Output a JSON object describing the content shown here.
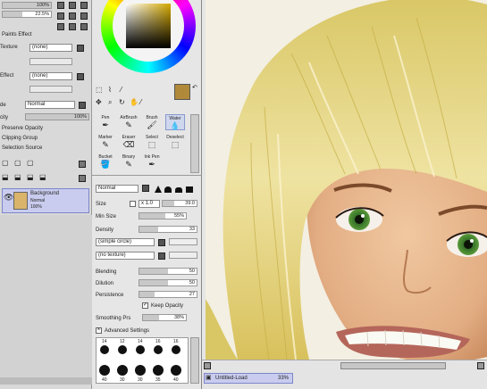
{
  "layer_panel": {
    "top_values": [
      "100%",
      "22.5%"
    ],
    "paper_effect_title": "Paints Effect",
    "texture_label": "Texture",
    "texture_value": "(none)",
    "effect_label": "Effect",
    "effect_value": "(none)",
    "mode_label": "de",
    "mode_value": "Normal",
    "opacity_label": "city",
    "opacity_value": "100%",
    "preserve_opacity": "Preserve Opacity",
    "clipping_group": "Clipping Group",
    "selection_source": "Selection Source",
    "layer": {
      "name": "Background",
      "mode": "Normal",
      "opacity": "100%"
    }
  },
  "tool_panel": {
    "tools_row1": [
      {
        "name": "Pen",
        "glyph": "✒"
      },
      {
        "name": "AirBrush",
        "glyph": "✎"
      },
      {
        "name": "Brush",
        "glyph": "🖌"
      },
      {
        "name": "Water",
        "glyph": "💧"
      }
    ],
    "tools_row2": [
      {
        "name": "Marker",
        "glyph": "✎"
      },
      {
        "name": "Eraser",
        "glyph": "⌫"
      },
      {
        "name": "Select",
        "glyph": "⬚"
      },
      {
        "name": "Deselect",
        "glyph": "⬚"
      }
    ],
    "tools_row3": [
      {
        "name": "Bucket",
        "glyph": "🪣"
      },
      {
        "name": "Binary",
        "glyph": "✎"
      },
      {
        "name": "Ink Pen",
        "glyph": "✒"
      },
      {
        "name": "",
        "glyph": ""
      }
    ],
    "blend_mode": "Normal",
    "size_label": "Size",
    "size_mult": "x 1.0",
    "size_value": "39.0",
    "min_size_label": "Min Size",
    "min_size_value": "55%",
    "density_label": "Density",
    "density_value": "33",
    "shape_value": "(simple circle)",
    "texture_value": "(no texture)",
    "blending_label": "Blending",
    "blending_value": "50",
    "dilution_label": "Dilution",
    "dilution_value": "50",
    "persistence_label": "Persistence",
    "persistence_value": "27",
    "keep_opacity": "Keep Opacity",
    "smoothing_label": "Smoothing Prs",
    "smoothing_value": "38%",
    "advanced_settings": "Advanced Settings",
    "brush_sizes_row1": [
      "14",
      "12",
      "14",
      "16",
      "16"
    ],
    "brush_sizes_row2": [
      "40",
      "30",
      "30",
      "35",
      "40"
    ]
  },
  "canvas_tab": {
    "title": "Untitled-Load",
    "zoom": "33%"
  },
  "colors": {
    "accent_blue": "#c9ccee",
    "swatch": "#b08a3a",
    "hair": "#e6d27a",
    "skin": "#e7b98f"
  }
}
